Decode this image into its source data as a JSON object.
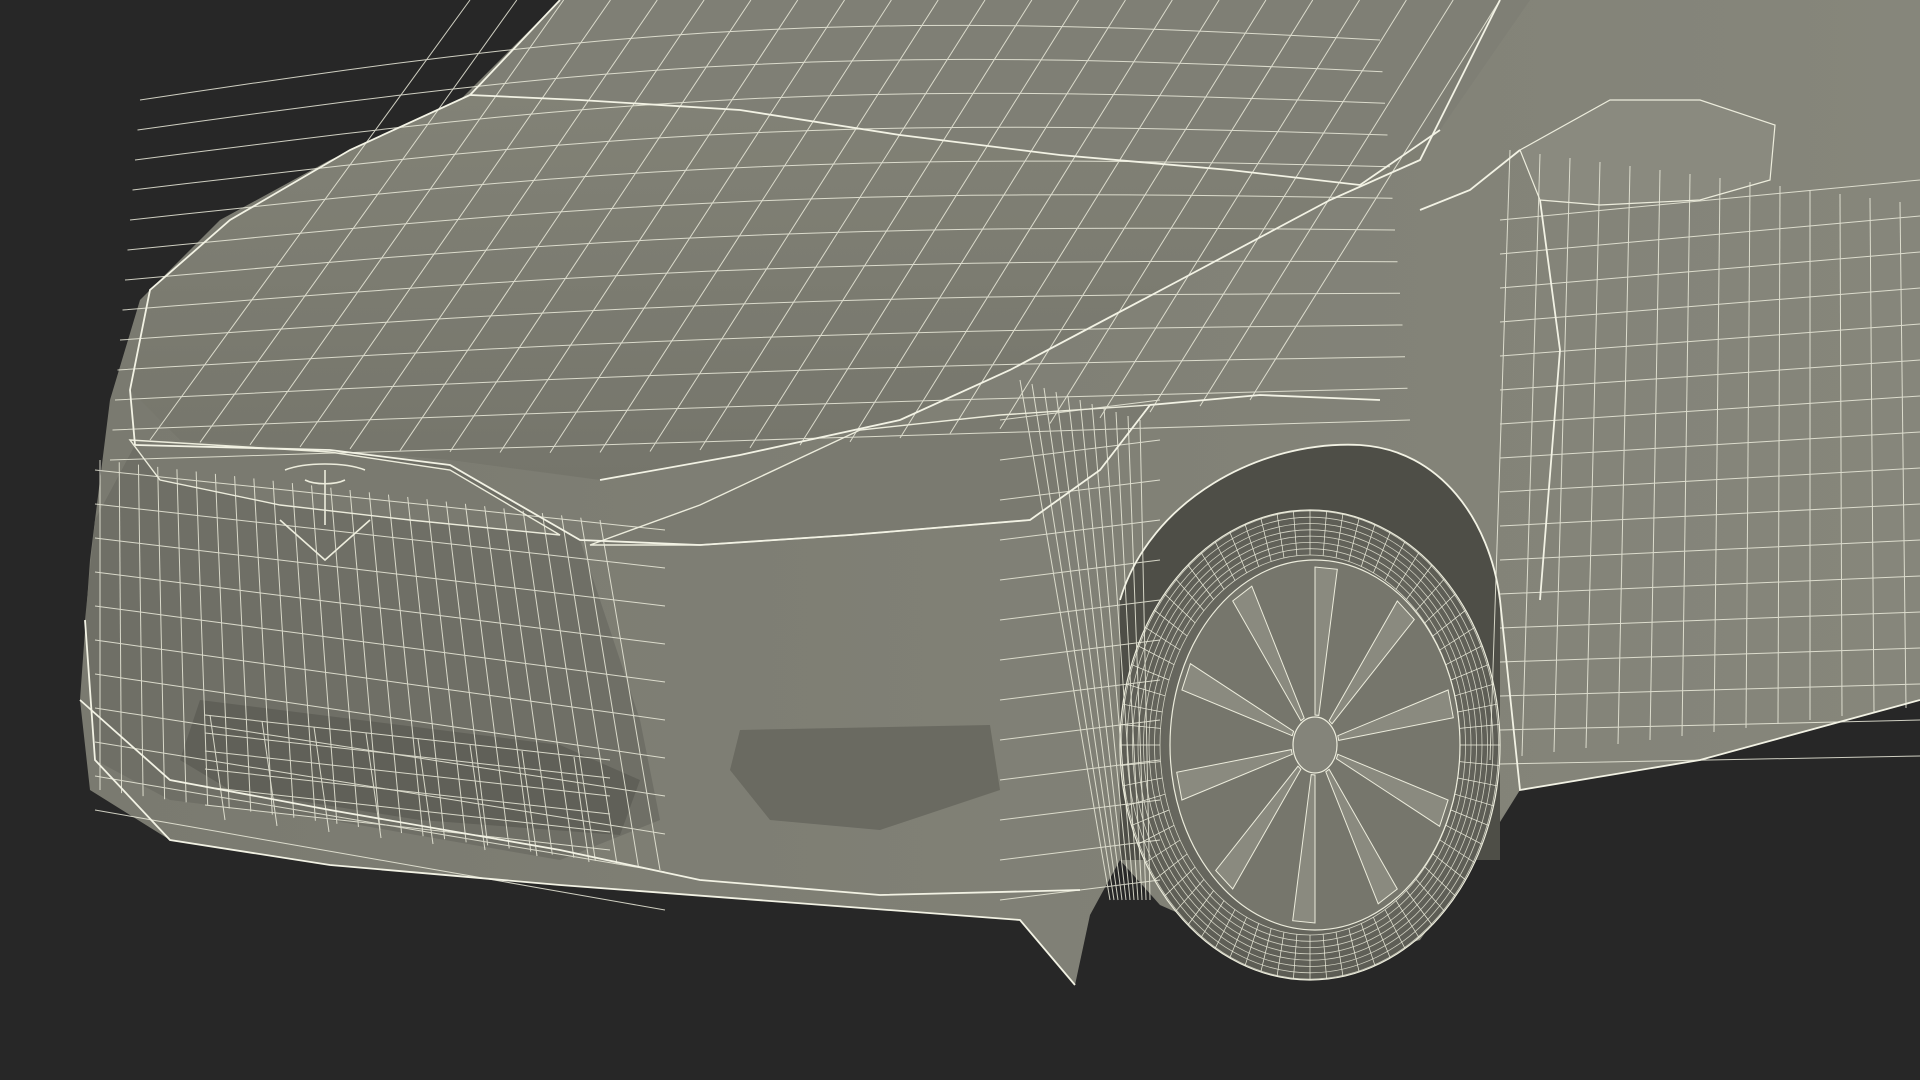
{
  "scene": {
    "subject": "wireframe-car-front",
    "colors": {
      "background": "#272727",
      "body_fill": "#7d7d72",
      "body_fill_dark": "#6a6a60",
      "body_fill_light": "#8c8c80",
      "wire": "#ececdc",
      "shadow": "#55554d"
    }
  }
}
